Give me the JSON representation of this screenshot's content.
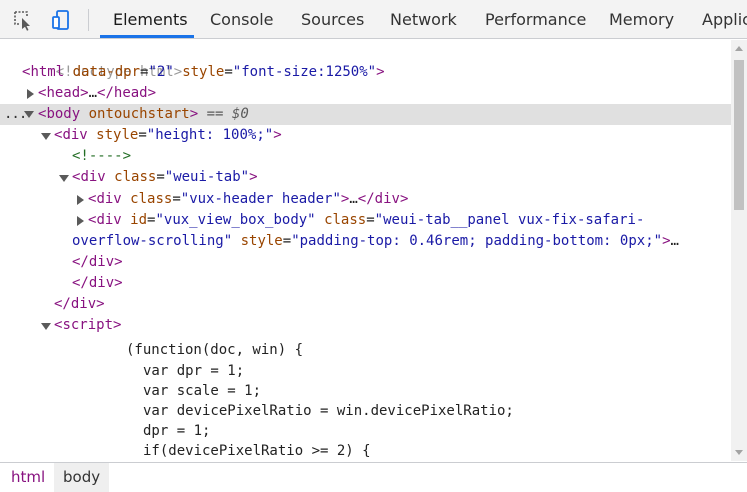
{
  "toolbar": {
    "tabs": [
      {
        "label": "Elements"
      },
      {
        "label": "Console"
      },
      {
        "label": "Sources"
      },
      {
        "label": "Network"
      },
      {
        "label": "Performance"
      },
      {
        "label": "Memory"
      },
      {
        "label": "Applic"
      }
    ],
    "active_tab": "Elements",
    "accent": "#1a73e8",
    "icons": [
      "inspect-element-icon",
      "device-toolbar-icon"
    ]
  },
  "dom_tree": {
    "doctype": "<!doctype html>",
    "html_tag": "html",
    "html_attr1_name": "data-dpr",
    "html_attr1_value": "\"2\"",
    "html_attr2_name": "style",
    "html_attr2_value": "\"font-size:1250%\"",
    "head_tag": "head",
    "ellipsis": "…",
    "body_tag": "body",
    "body_attr": "ontouchstart",
    "selected_marker": "== $0",
    "row_dots": "...",
    "div_style_name": "style",
    "div_style_value": "\"height: 100%;\"",
    "comment": "<!---->",
    "weui_tab_class_name": "class",
    "weui_tab_class_value": "\"weui-tab\"",
    "vux_header_class_value": "\"vux-header header\"",
    "view_box_id_name": "id",
    "view_box_id_value": "\"vux_view_box_body\"",
    "view_box_class_value_line1": "\"weui-tab__panel vux-fix-safari-",
    "view_box_class_value_line2": "overflow-scrolling\"",
    "view_box_style_value": "\"padding-top: 0.46rem; padding-bottom: 0px;\"",
    "trailing_ellipsis": "…",
    "div_tag": "div",
    "script_tag": "script",
    "script_lines": [
      "(function(doc, win) {",
      "var dpr = 1;",
      "var scale = 1;",
      "var devicePixelRatio = win.devicePixelRatio;",
      "dpr = 1;",
      "if(devicePixelRatio >= 2) {"
    ]
  },
  "breadcrumbs": [
    {
      "label": "html"
    },
    {
      "label": "body"
    }
  ],
  "colors": {
    "tag": "#881280",
    "attr_name": "#994500",
    "attr_value": "#1a1aa6",
    "comment": "#236e25",
    "selection_bg": "#e0e0e0"
  }
}
